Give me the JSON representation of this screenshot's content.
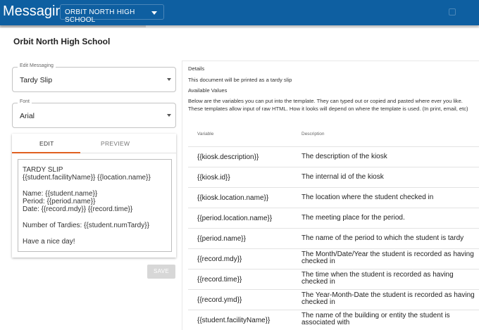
{
  "header": {
    "title": "Messaging -",
    "school_select": "ORBIT NORTH HIGH SCHOOL"
  },
  "page_title": "Orbit North High School",
  "edit_messaging": {
    "label": "Edit Messaging",
    "value": "Tardy Slip"
  },
  "font": {
    "label": "Font",
    "value": "Arial"
  },
  "editor": {
    "tabs": [
      "EDIT",
      "PREVIEW"
    ],
    "active_tab": "EDIT",
    "lines": [
      "TARDY SLIP",
      "{{student.facilityName}} {{location.name}}",
      "",
      "Name: {{student.name}}",
      "Period: {{period.name}}",
      "Date: {{record.mdy}} {{record.time}}",
      "",
      "Number of Tardies: {{student.numTardy}}",
      "",
      "Have a nice day!"
    ]
  },
  "save_label": "SAVE",
  "details": {
    "heading": "Details",
    "subtitle": "This document will be printed as a tardy slip",
    "available_heading": "Available Values",
    "available_desc": "Below are the variables you can put into the template. They can typed out or copied and pasted where ever you like. These templates allow input of raw HTML. How it looks will depend on where the template is used. (In print, email, etc)",
    "columns": [
      "Variable",
      "Description"
    ],
    "rows": [
      {
        "variable": "{{kiosk.description}}",
        "description": "The description of the kiosk"
      },
      {
        "variable": "{{kiosk.id}}",
        "description": "The internal id of the kiosk"
      },
      {
        "variable": "{{kiosk.location.name}}",
        "description": "The location where the student checked in"
      },
      {
        "variable": "{{period.location.name}}",
        "description": "The meeting place for the period."
      },
      {
        "variable": "{{period.name}}",
        "description": "The name of the period to which the student is tardy"
      },
      {
        "variable": "{{record.mdy}}",
        "description": "The Month/Date/Year the student is recorded as having checked in"
      },
      {
        "variable": "{{record.time}}",
        "description": "The time when the student is recorded as having checked in"
      },
      {
        "variable": "{{record.ymd}}",
        "description": "The Year-Month-Date the student is recorded as having checked in"
      },
      {
        "variable": "{{student.facilityName}}",
        "description": "The name of the building or entity the student is associated with"
      }
    ]
  }
}
